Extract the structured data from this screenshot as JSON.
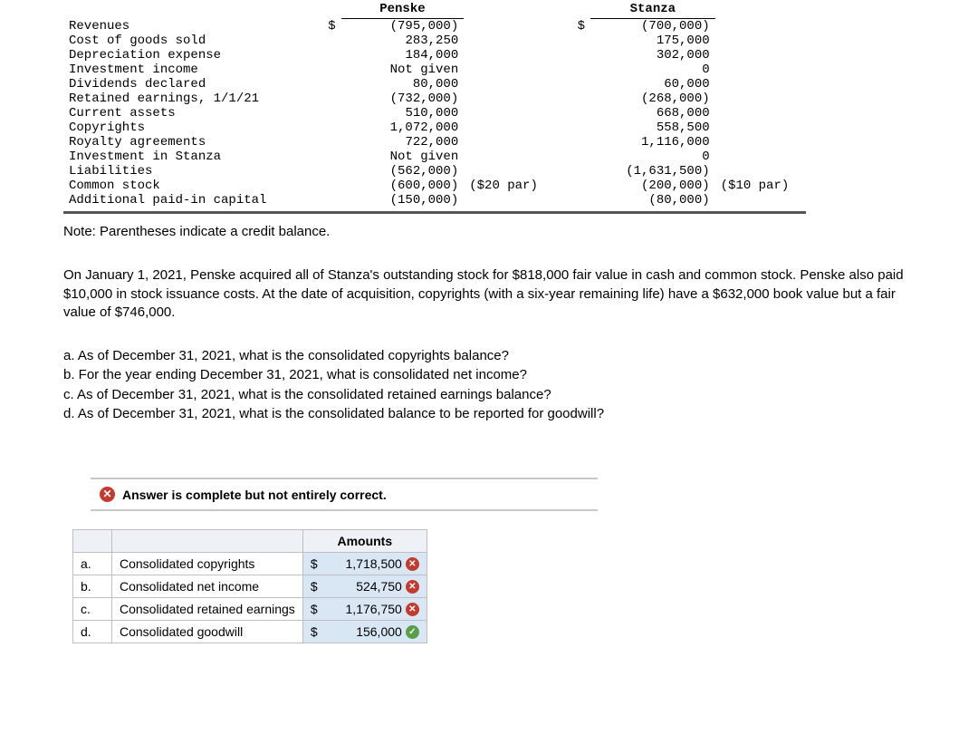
{
  "headers": {
    "col1": "Penske",
    "col2": "Stanza"
  },
  "rows": [
    {
      "label": "Revenues",
      "d1": "$",
      "v1": "(795,000)",
      "e1": "",
      "d2": "$",
      "v2": "(700,000)",
      "e2": ""
    },
    {
      "label": "Cost of goods sold",
      "d1": "",
      "v1": "283,250",
      "e1": "",
      "d2": "",
      "v2": "175,000",
      "e2": ""
    },
    {
      "label": "Depreciation expense",
      "d1": "",
      "v1": "184,000",
      "e1": "",
      "d2": "",
      "v2": "302,000",
      "e2": ""
    },
    {
      "label": "Investment income",
      "d1": "",
      "v1": "Not given",
      "e1": "",
      "d2": "",
      "v2": "0",
      "e2": ""
    },
    {
      "label": "Dividends declared",
      "d1": "",
      "v1": "80,000",
      "e1": "",
      "d2": "",
      "v2": "60,000",
      "e2": ""
    },
    {
      "label": "Retained earnings, 1/1/21",
      "d1": "",
      "v1": "(732,000)",
      "e1": "",
      "d2": "",
      "v2": "(268,000)",
      "e2": ""
    },
    {
      "label": "Current assets",
      "d1": "",
      "v1": "510,000",
      "e1": "",
      "d2": "",
      "v2": "668,000",
      "e2": ""
    },
    {
      "label": "Copyrights",
      "d1": "",
      "v1": "1,072,000",
      "e1": "",
      "d2": "",
      "v2": "558,500",
      "e2": ""
    },
    {
      "label": "Royalty agreements",
      "d1": "",
      "v1": "722,000",
      "e1": "",
      "d2": "",
      "v2": "1,116,000",
      "e2": ""
    },
    {
      "label": "Investment in Stanza",
      "d1": "",
      "v1": "Not given",
      "e1": "",
      "d2": "",
      "v2": "0",
      "e2": ""
    },
    {
      "label": "Liabilities",
      "d1": "",
      "v1": "(562,000)",
      "e1": "",
      "d2": "",
      "v2": "(1,631,500)",
      "e2": ""
    },
    {
      "label": "Common stock",
      "d1": "",
      "v1": "(600,000)",
      "e1": "($20 par)",
      "d2": "",
      "v2": "(200,000)",
      "e2": "($10 par)"
    },
    {
      "label": "Additional paid-in capital",
      "d1": "",
      "v1": "(150,000)",
      "e1": "",
      "d2": "",
      "v2": "(80,000)",
      "e2": ""
    }
  ],
  "note": "Note: Parentheses indicate a credit balance.",
  "paragraph": "On January 1, 2021, Penske acquired all of Stanza's outstanding stock for $818,000 fair value in cash and common stock. Penske also paid $10,000 in stock issuance costs. At the date of acquisition, copyrights (with a six-year remaining life) have a $632,000 book value but a fair value of $746,000.",
  "questions": {
    "a": "a. As of December 31, 2021, what is the consolidated copyrights balance?",
    "b": "b. For the year ending December 31, 2021, what is consolidated net income?",
    "c": "c. As of December 31, 2021, what is the consolidated retained earnings balance?",
    "d": "d. As of December 31, 2021, what is the consolidated balance to be reported for goodwill?"
  },
  "feedback_msg": "Answer is complete but not entirely correct.",
  "amounts_header": "Amounts",
  "answers": [
    {
      "letter": "a.",
      "label": "Consolidated copyrights",
      "amt": "1,718,500",
      "ok": false
    },
    {
      "letter": "b.",
      "label": "Consolidated net income",
      "amt": "524,750",
      "ok": false
    },
    {
      "letter": "c.",
      "label": "Consolidated retained earnings",
      "amt": "1,176,750",
      "ok": false
    },
    {
      "letter": "d.",
      "label": "Consolidated goodwill",
      "amt": "156,000",
      "ok": true
    }
  ],
  "currency": "$",
  "x_glyph": "✕",
  "ok_glyph": "✓"
}
